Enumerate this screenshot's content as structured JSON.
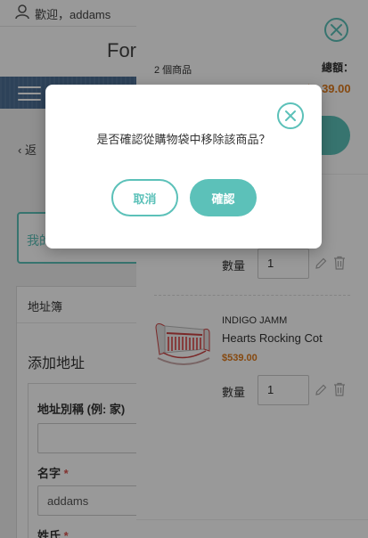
{
  "header": {
    "welcome": "歡迎，addams",
    "brand_partial": "For"
  },
  "background": {
    "back_label": "返",
    "account_label": "我的",
    "address_book": "地址簿",
    "add_address_title": "添加地址",
    "form": {
      "alias_label": "地址別稱 (例: 家)",
      "alias_value": "",
      "first_name_label": "名字",
      "first_name_value": "addams",
      "last_name_label": "姓氏",
      "required_mark": "*"
    }
  },
  "cart": {
    "item_count": "2 個商品",
    "total_label": "總額：",
    "total_value": "$...39.00",
    "items": [
      {
        "quantity_label": "數量",
        "quantity": "1"
      },
      {
        "brand": "INDIGO JAMM",
        "name": "Hearts Rocking Cot",
        "price": "$539.00",
        "quantity_label": "數量",
        "quantity": "1"
      }
    ]
  },
  "dialog": {
    "message": "是否確認從購物袋中移除該商品？",
    "cancel_label": "取消",
    "confirm_label": "確認"
  },
  "colors": {
    "accent": "#5cc1b9",
    "price": "#e07b1c",
    "nav": "#4b6f95"
  },
  "icons": [
    "user-icon",
    "menu-icon",
    "close-icon",
    "edit-icon",
    "trash-icon"
  ]
}
